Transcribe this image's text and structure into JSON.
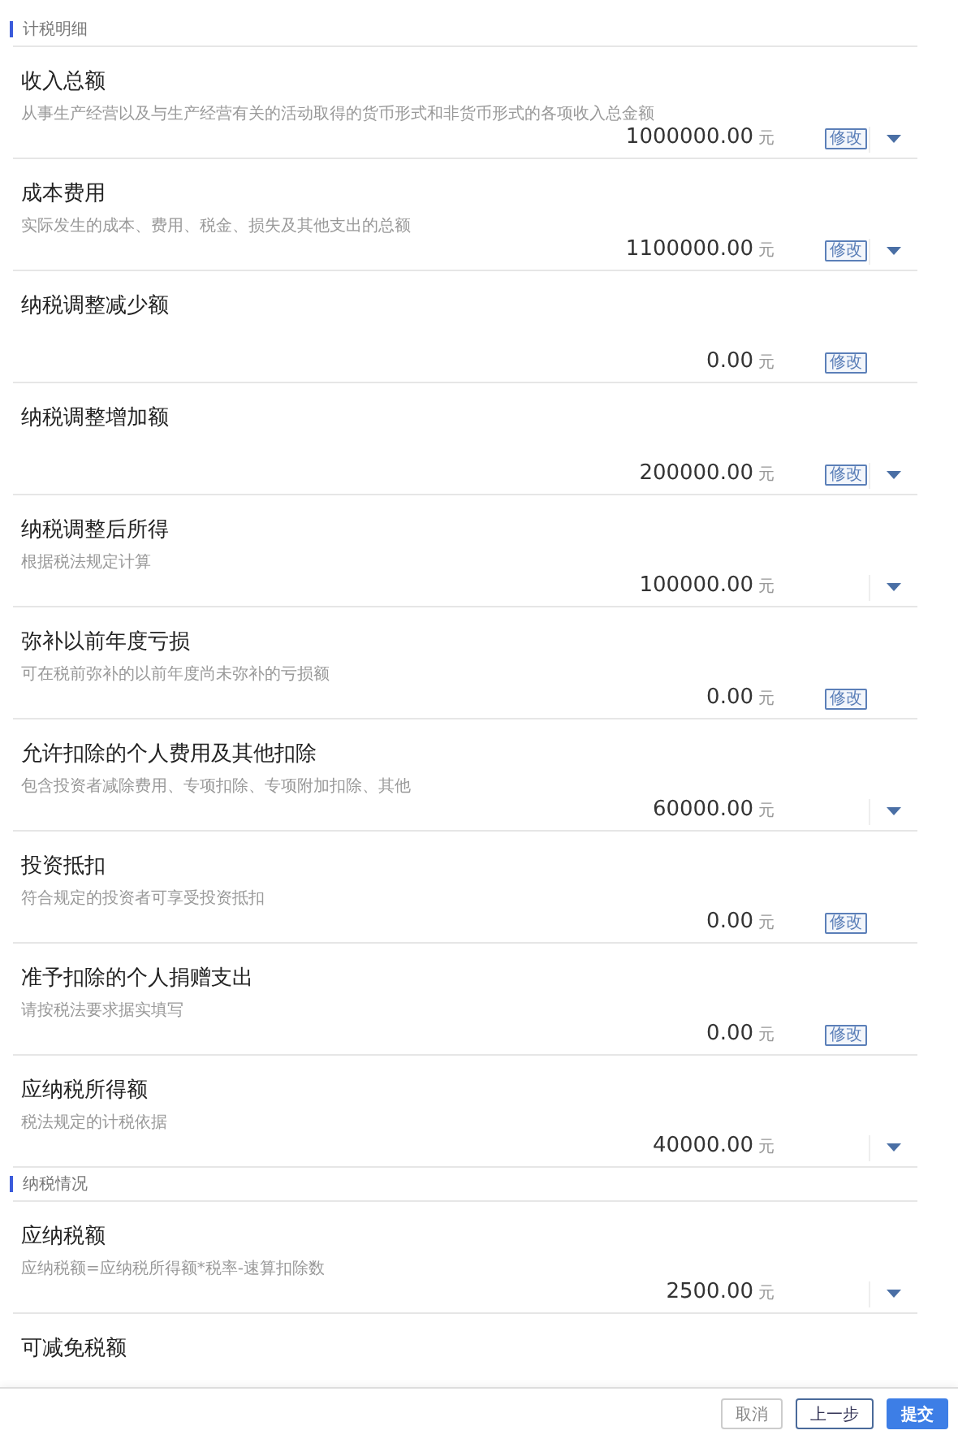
{
  "sections": [
    {
      "title": "计税明细",
      "rows": [
        {
          "label": "收入总额",
          "description": "从事生产经营以及与生产经营有关的活动取得的货币形式和非货币形式的各项收入总金额",
          "value": "1000000.00",
          "unit": "元",
          "edit_button": "修改",
          "expandable": true
        },
        {
          "label": "成本费用",
          "description": "实际发生的成本、费用、税金、损失及其他支出的总额",
          "value": "1100000.00",
          "unit": "元",
          "edit_button": "修改",
          "expandable": true
        },
        {
          "label": "纳税调整减少额",
          "value": "0.00",
          "unit": "元",
          "edit_button": "修改",
          "expandable": false
        },
        {
          "label": "纳税调整增加额",
          "value": "200000.00",
          "unit": "元",
          "edit_button": "修改",
          "expandable": true
        },
        {
          "label": "纳税调整后所得",
          "description": "根据税法规定计算",
          "value": "100000.00",
          "unit": "元",
          "expandable": true
        },
        {
          "label": "弥补以前年度亏损",
          "description": "可在税前弥补的以前年度尚未弥补的亏损额",
          "value": "0.00",
          "unit": "元",
          "edit_button": "修改",
          "expandable": false
        },
        {
          "label": "允许扣除的个人费用及其他扣除",
          "description": "包含投资者减除费用、专项扣除、专项附加扣除、其他",
          "value": "60000.00",
          "unit": "元",
          "expandable": true
        },
        {
          "label": "投资抵扣",
          "description": "符合规定的投资者可享受投资抵扣",
          "value": "0.00",
          "unit": "元",
          "edit_button": "修改",
          "expandable": false
        },
        {
          "label": "准予扣除的个人捐赠支出",
          "description": "请按税法要求据实填写",
          "value": "0.00",
          "unit": "元",
          "edit_button": "修改",
          "expandable": false
        },
        {
          "label": "应纳税所得额",
          "description": "税法规定的计税依据",
          "value": "40000.00",
          "unit": "元",
          "expandable": true
        }
      ]
    },
    {
      "title": "纳税情况",
      "rows": [
        {
          "label": "应纳税额",
          "description": "应纳税额=应纳税所得额*税率-速算扣除数",
          "value": "2500.00",
          "unit": "元",
          "expandable": true
        },
        {
          "label": "可减免税额"
        }
      ]
    }
  ],
  "footer_buttons": [
    {
      "label": "取消",
      "kind": "default"
    },
    {
      "label": "上一步",
      "kind": "outline"
    },
    {
      "label": "提交",
      "kind": "primary"
    }
  ]
}
